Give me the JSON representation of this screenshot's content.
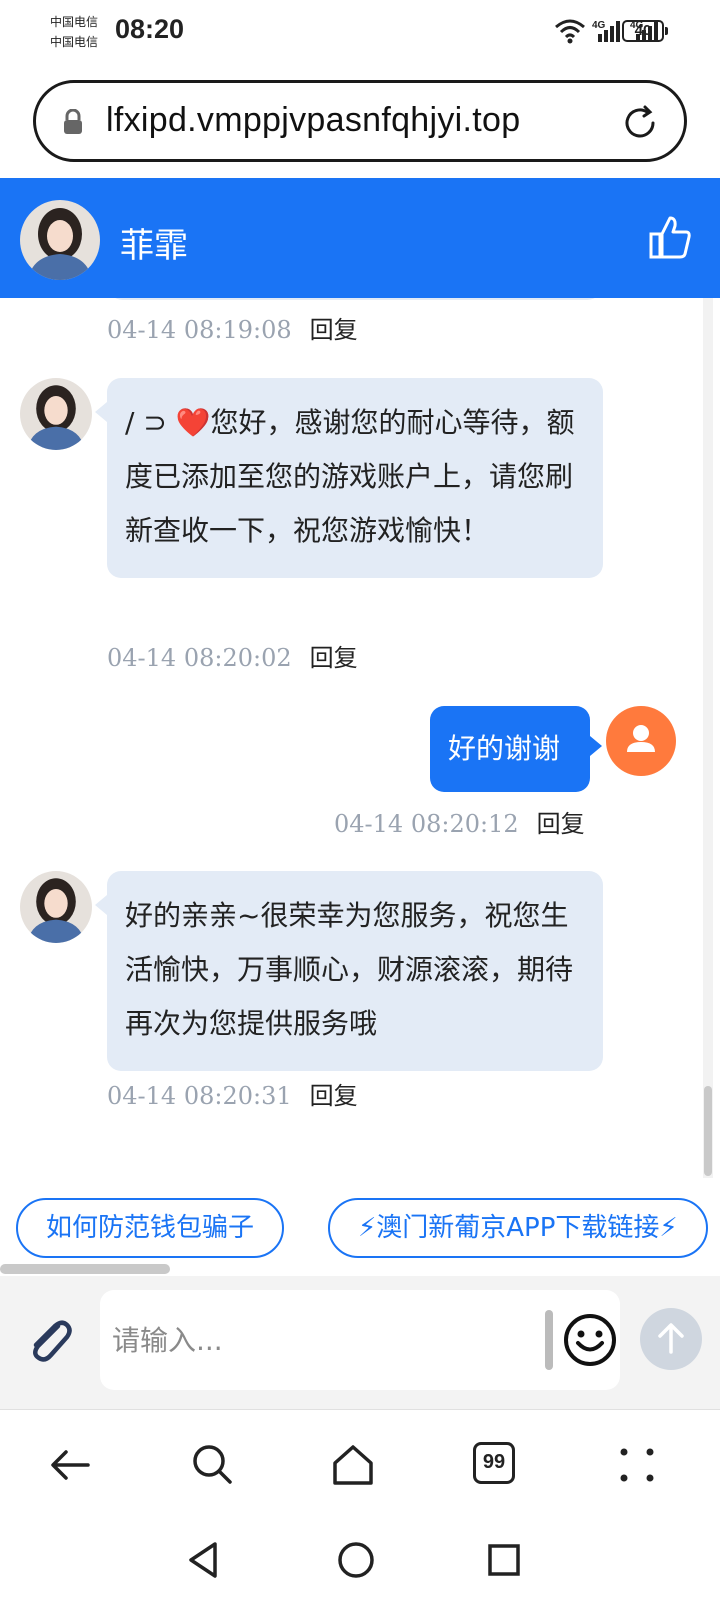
{
  "status_bar": {
    "carrier_1": "中国电信",
    "carrier_2": "中国电信",
    "time": "08:20",
    "network_1": "4G",
    "network_2": "4G",
    "battery": "40"
  },
  "browser": {
    "url": "lfxipd.vmppjvpasnfqhjyi.top",
    "icons": {
      "lock": "lock-icon",
      "reload": "reload-icon"
    }
  },
  "chat_header": {
    "title": "菲霏",
    "background": "#1a74f5",
    "like_icon": "thumbs-up-icon"
  },
  "messages": [
    {
      "from": "agent",
      "text": "",
      "time": "04-14 08:19:08",
      "reply": "回复"
    },
    {
      "from": "agent",
      "text": "/ ⊃ ❤️您好，感谢您的耐心等待，额度已添加至您的游戏账户上，请您刷新查收一下，祝您游戏愉快！",
      "time": "04-14 08:20:02",
      "reply": "回复"
    },
    {
      "from": "user",
      "text": "好的谢谢",
      "time": "04-14 08:20:12",
      "reply": "回复"
    },
    {
      "from": "agent",
      "text": "好的亲亲~很荣幸为您服务，祝您生活愉快，万事顺心，财源滚滚，期待再次为您提供服务哦",
      "time": "04-14 08:20:31",
      "reply": "回复"
    }
  ],
  "quick_replies": [
    {
      "label": "如何防范钱包骗子"
    },
    {
      "label": "⚡澳门新葡京APP下载链接⚡"
    }
  ],
  "composer": {
    "placeholder": "请输入...",
    "attach_icon": "paperclip-icon",
    "emoji_icon": "smiley-icon",
    "send_icon": "arrow-up-icon"
  },
  "browser_nav": {
    "tabs_count": "99",
    "icons": [
      "back-arrow-icon",
      "search-icon",
      "home-icon",
      "tabs-icon",
      "more-icon"
    ]
  },
  "colors": {
    "accent": "#1a74f5",
    "agent_bubble": "#e3ebf6",
    "user_avatar": "#ff7a3d"
  }
}
